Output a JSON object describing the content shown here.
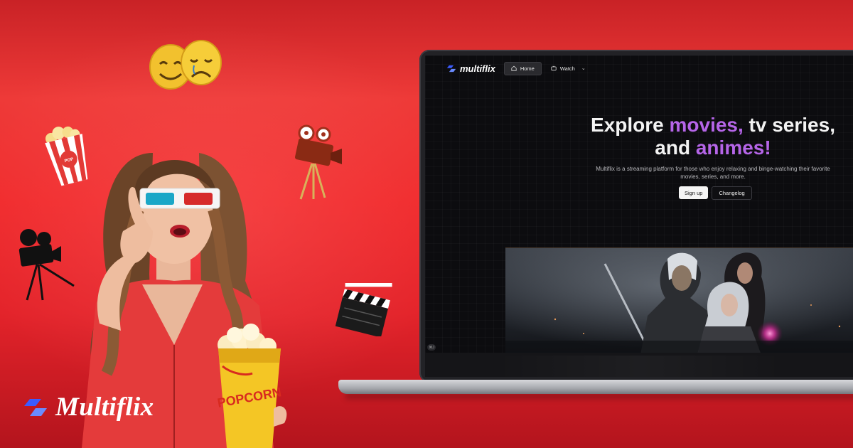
{
  "brand": {
    "name": "Multiflix"
  },
  "app": {
    "logo_text": "multiflix",
    "nav": {
      "home_label": "Home",
      "watch_label": "Watch"
    },
    "hero": {
      "title_part1": "Explore ",
      "title_accent1": "movies,",
      "title_part2": " tv series, and ",
      "title_accent2": "animes!",
      "subtitle": "Multiflix is a streaming platform for those who enjoy relaxing and binge-watching their favorite movies, series, and more.",
      "signup_label": "Sign up",
      "changelog_label": "Changelog"
    },
    "badge": "⌘J"
  },
  "props": {
    "popcorn_box_text": "POPCORN",
    "popcorn_bucket_text": "POPCORN",
    "small_popcorn_text": "POP CORN"
  },
  "colors": {
    "accent": "#b565e8",
    "brand_red": "#ee3a38",
    "logo_blue": "#3b5bff"
  }
}
